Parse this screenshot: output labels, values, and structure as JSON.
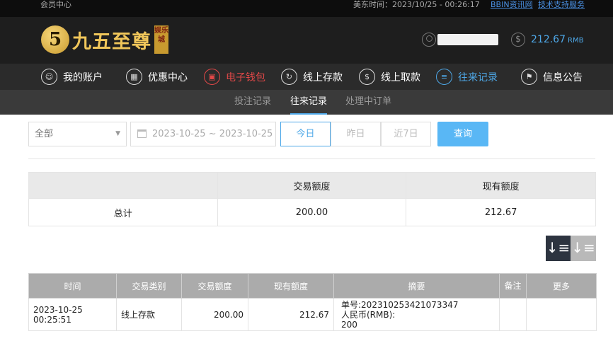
{
  "topbar": {
    "title": "会员中心",
    "time_label": "美东时间：2023/10/25 - 00:26:17",
    "links": [
      "BBIN资讯网",
      "技术支持服务"
    ]
  },
  "header": {
    "logo_numeral": "5",
    "logo_text": "九五至尊",
    "logo_seal": "娱乐城",
    "balance": "212.67",
    "currency": "RMB"
  },
  "nav": {
    "items": [
      {
        "label": "我的账户",
        "icon": "user-icon"
      },
      {
        "label": "优惠中心",
        "icon": "gift-icon"
      },
      {
        "label": "电子钱包",
        "icon": "wallet-icon"
      },
      {
        "label": "线上存款",
        "icon": "deposit-icon"
      },
      {
        "label": "线上取款",
        "icon": "withdraw-icon"
      },
      {
        "label": "往来记录",
        "icon": "record-icon"
      },
      {
        "label": "信息公告",
        "icon": "bell-icon"
      }
    ],
    "active_color": "#4ea8e8",
    "highlight_color": "#e14848"
  },
  "subnav": {
    "items": [
      "投注记录",
      "往来记录",
      "处理中订单"
    ],
    "active": "往来记录"
  },
  "filters": {
    "type_selected": "全部",
    "date_range": "2023-10-25 ~ 2023-10-25",
    "quick": [
      "今日",
      "昨日",
      "近7日"
    ],
    "quick_active": "今日",
    "search_label": "查询"
  },
  "summary": {
    "headers": [
      "",
      "交易额度",
      "现有额度"
    ],
    "row": [
      "总计",
      "200.00",
      "212.67"
    ]
  },
  "detail": {
    "headers": [
      "时间",
      "交易类别",
      "交易额度",
      "现有额度",
      "摘要",
      "备注",
      "更多"
    ],
    "rows": [
      {
        "time": "2023-10-25 00:25:51",
        "type": "线上存款",
        "amount": "200.00",
        "balance": "212.67",
        "memo_line1": "单号:202310253421073347",
        "memo_line2": "人民币(RMB):",
        "memo_line3": "200",
        "note": "",
        "more": ""
      }
    ]
  }
}
